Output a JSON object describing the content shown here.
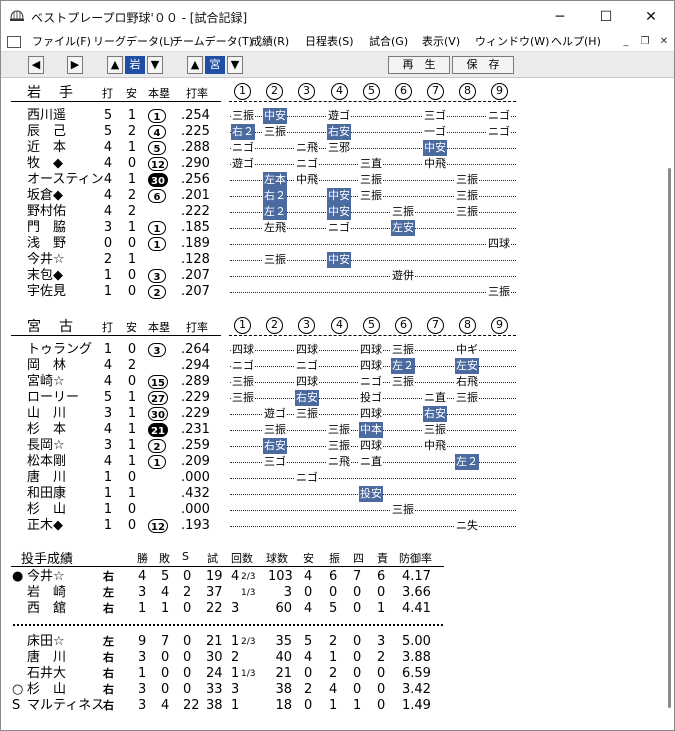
{
  "window": {
    "title": "ベストプレープロ野球'００ - [試合記録]"
  },
  "menu": [
    "ファイル(F)",
    "リーグデータ(L)",
    "チームデータ(T)",
    "成績(R)",
    "日程表(S)",
    "試合(G)",
    "表示(V)",
    "ウィンドウ(W)",
    "ヘルプ(H)"
  ],
  "toolbar": {
    "team1": "岩",
    "team2": "宮",
    "play": "再　生",
    "save": "保　存"
  },
  "cols": {
    "ab": "打",
    "h": "安",
    "hr": "本塁",
    "avg": "打率",
    "innings": [
      "1",
      "2",
      "3",
      "4",
      "5",
      "6",
      "7",
      "8",
      "9"
    ]
  },
  "team1": {
    "name": "岩　手",
    "players": [
      {
        "name": "西川遥",
        "ab": "5",
        "h": "1",
        "hr": "1",
        "hrf": false,
        "avg": ".254",
        "res": [
          [
            "三振",
            0
          ],
          [
            "中安",
            1
          ],
          [
            "",
            0
          ],
          [
            "遊ゴ",
            0
          ],
          [
            "",
            0
          ],
          [
            "",
            0
          ],
          [
            "三ゴ",
            0
          ],
          [
            "",
            0
          ],
          [
            "ニゴ",
            0
          ]
        ]
      },
      {
        "name": "辰　己",
        "ab": "5",
        "h": "2",
        "hr": "4",
        "hrf": false,
        "avg": ".225",
        "res": [
          [
            "右２",
            1
          ],
          [
            "三振",
            0
          ],
          [
            "",
            0
          ],
          [
            "右安",
            1
          ],
          [
            "",
            0
          ],
          [
            "",
            0
          ],
          [
            "一ゴ",
            0
          ],
          [
            "",
            0
          ],
          [
            "ニゴ",
            0
          ]
        ]
      },
      {
        "name": "近　本",
        "ab": "4",
        "h": "1",
        "hr": "5",
        "hrf": false,
        "avg": ".288",
        "res": [
          [
            "ニゴ",
            0
          ],
          [
            "",
            0
          ],
          [
            "ニ飛",
            0
          ],
          [
            "三邪",
            0
          ],
          [
            "",
            0
          ],
          [
            "",
            0
          ],
          [
            "中安",
            1
          ],
          [
            "",
            0
          ],
          [
            "",
            0
          ]
        ]
      },
      {
        "name": "牧　◆",
        "ab": "4",
        "h": "0",
        "hr": "12",
        "hrf": false,
        "avg": ".290",
        "res": [
          [
            "遊ゴ",
            0
          ],
          [
            "",
            0
          ],
          [
            "ニゴ",
            0
          ],
          [
            "",
            0
          ],
          [
            "三直",
            0
          ],
          [
            "",
            0
          ],
          [
            "中飛",
            0
          ],
          [
            "",
            0
          ],
          [
            "",
            0
          ]
        ]
      },
      {
        "name": "オースティン",
        "ab": "4",
        "h": "1",
        "hr": "30",
        "hrf": true,
        "avg": ".256",
        "res": [
          [
            "",
            0
          ],
          [
            "左本",
            1
          ],
          [
            "中飛",
            0
          ],
          [
            "",
            0
          ],
          [
            "三振",
            0
          ],
          [
            "",
            0
          ],
          [
            "",
            0
          ],
          [
            "三振",
            0
          ],
          [
            "",
            0
          ]
        ]
      },
      {
        "name": "坂倉◆",
        "ab": "4",
        "h": "2",
        "hr": "6",
        "hrf": false,
        "avg": ".201",
        "res": [
          [
            "",
            0
          ],
          [
            "右２",
            1
          ],
          [
            "",
            0
          ],
          [
            "中安",
            1
          ],
          [
            "三振",
            0
          ],
          [
            "",
            0
          ],
          [
            "",
            0
          ],
          [
            "三振",
            0
          ],
          [
            "",
            0
          ]
        ]
      },
      {
        "name": "野村佑",
        "ab": "4",
        "h": "2",
        "hr": "",
        "hrf": false,
        "avg": ".222",
        "res": [
          [
            "",
            0
          ],
          [
            "左２",
            1
          ],
          [
            "",
            0
          ],
          [
            "中安",
            1
          ],
          [
            "",
            0
          ],
          [
            "三振",
            0
          ],
          [
            "",
            0
          ],
          [
            "三振",
            0
          ],
          [
            "",
            0
          ]
        ]
      },
      {
        "name": "門　脇",
        "ab": "3",
        "h": "1",
        "hr": "1",
        "hrf": false,
        "avg": ".185",
        "res": [
          [
            "",
            0
          ],
          [
            "左飛",
            0
          ],
          [
            "",
            0
          ],
          [
            "ニゴ",
            0
          ],
          [
            "",
            0
          ],
          [
            "左安",
            1
          ],
          [
            "",
            0
          ],
          [
            "",
            0
          ],
          [
            "",
            0
          ]
        ]
      },
      {
        "name": "浅　野",
        "ab": "0",
        "h": "0",
        "hr": "1",
        "hrf": false,
        "avg": ".189",
        "res": [
          [
            "",
            0
          ],
          [
            "",
            0
          ],
          [
            "",
            0
          ],
          [
            "",
            0
          ],
          [
            "",
            0
          ],
          [
            "",
            0
          ],
          [
            "",
            0
          ],
          [
            "",
            0
          ],
          [
            "四球",
            0
          ]
        ]
      },
      {
        "name": "今井☆",
        "ab": "2",
        "h": "1",
        "hr": "",
        "hrf": false,
        "avg": ".128",
        "res": [
          [
            "",
            0
          ],
          [
            "三振",
            0
          ],
          [
            "",
            0
          ],
          [
            "中安",
            1
          ],
          [
            "",
            0
          ],
          [
            "",
            0
          ],
          [
            "",
            0
          ],
          [
            "",
            0
          ],
          [
            "",
            0
          ]
        ]
      },
      {
        "name": "末包◆",
        "ab": "1",
        "h": "0",
        "hr": "3",
        "hrf": false,
        "avg": ".207",
        "res": [
          [
            "",
            0
          ],
          [
            "",
            0
          ],
          [
            "",
            0
          ],
          [
            "",
            0
          ],
          [
            "",
            0
          ],
          [
            "遊併",
            0
          ],
          [
            "",
            0
          ],
          [
            "",
            0
          ],
          [
            "",
            0
          ]
        ]
      },
      {
        "name": "宇佐見",
        "ab": "1",
        "h": "0",
        "hr": "2",
        "hrf": false,
        "avg": ".207",
        "res": [
          [
            "",
            0
          ],
          [
            "",
            0
          ],
          [
            "",
            0
          ],
          [
            "",
            0
          ],
          [
            "",
            0
          ],
          [
            "",
            0
          ],
          [
            "",
            0
          ],
          [
            "",
            0
          ],
          [
            "三振",
            0
          ]
        ]
      }
    ]
  },
  "team2": {
    "name": "宮　古",
    "players": [
      {
        "name": "トゥラング",
        "ab": "1",
        "h": "0",
        "hr": "3",
        "hrf": false,
        "avg": ".264",
        "res": [
          [
            "四球",
            0
          ],
          [
            "",
            0
          ],
          [
            "四球",
            0
          ],
          [
            "",
            0
          ],
          [
            "四球",
            0
          ],
          [
            "三振",
            0
          ],
          [
            "",
            0
          ],
          [
            "中ギ",
            0
          ],
          [
            "",
            0
          ]
        ]
      },
      {
        "name": "岡　林",
        "ab": "4",
        "h": "2",
        "hr": "",
        "hrf": false,
        "avg": ".294",
        "res": [
          [
            "ニゴ",
            0
          ],
          [
            "",
            0
          ],
          [
            "ニゴ",
            0
          ],
          [
            "",
            0
          ],
          [
            "四球",
            0
          ],
          [
            "左２",
            1
          ],
          [
            "",
            0
          ],
          [
            "左安",
            1
          ],
          [
            "",
            0
          ]
        ]
      },
      {
        "name": "宮崎☆",
        "ab": "4",
        "h": "0",
        "hr": "15",
        "hrf": false,
        "avg": ".289",
        "res": [
          [
            "三振",
            0
          ],
          [
            "",
            0
          ],
          [
            "四球",
            0
          ],
          [
            "",
            0
          ],
          [
            "ニゴ",
            0
          ],
          [
            "三振",
            0
          ],
          [
            "",
            0
          ],
          [
            "右飛",
            0
          ],
          [
            "",
            0
          ]
        ]
      },
      {
        "name": "ローリー",
        "ab": "5",
        "h": "1",
        "hr": "27",
        "hrf": false,
        "avg": ".229",
        "res": [
          [
            "三振",
            0
          ],
          [
            "",
            0
          ],
          [
            "右安",
            1
          ],
          [
            "",
            0
          ],
          [
            "投ゴ",
            0
          ],
          [
            "",
            0
          ],
          [
            "ニ直",
            0
          ],
          [
            "三振",
            0
          ],
          [
            "",
            0
          ]
        ]
      },
      {
        "name": "山　川",
        "ab": "3",
        "h": "1",
        "hr": "30",
        "hrf": false,
        "avg": ".229",
        "res": [
          [
            "",
            0
          ],
          [
            "遊ゴ",
            0
          ],
          [
            "三振",
            0
          ],
          [
            "",
            0
          ],
          [
            "四球",
            0
          ],
          [
            "",
            0
          ],
          [
            "右安",
            1
          ],
          [
            "",
            0
          ],
          [
            "",
            0
          ]
        ]
      },
      {
        "name": "杉　本",
        "ab": "4",
        "h": "1",
        "hr": "21",
        "hrf": true,
        "avg": ".231",
        "res": [
          [
            "",
            0
          ],
          [
            "三振",
            0
          ],
          [
            "",
            0
          ],
          [
            "三振",
            0
          ],
          [
            "中本",
            1
          ],
          [
            "",
            0
          ],
          [
            "三振",
            0
          ],
          [
            "",
            0
          ],
          [
            "",
            0
          ]
        ]
      },
      {
        "name": "長岡☆",
        "ab": "3",
        "h": "1",
        "hr": "2",
        "hrf": false,
        "avg": ".259",
        "res": [
          [
            "",
            0
          ],
          [
            "右安",
            1
          ],
          [
            "",
            0
          ],
          [
            "三振",
            0
          ],
          [
            "四球",
            0
          ],
          [
            "",
            0
          ],
          [
            "中飛",
            0
          ],
          [
            "",
            0
          ],
          [
            "",
            0
          ]
        ]
      },
      {
        "name": "松本剛",
        "ab": "4",
        "h": "1",
        "hr": "1",
        "hrf": false,
        "avg": ".209",
        "res": [
          [
            "",
            0
          ],
          [
            "三ゴ",
            0
          ],
          [
            "",
            0
          ],
          [
            "ニ飛",
            0
          ],
          [
            "ニ直",
            0
          ],
          [
            "",
            0
          ],
          [
            "",
            0
          ],
          [
            "左２",
            1
          ],
          [
            "",
            0
          ]
        ]
      },
      {
        "name": "唐　川",
        "ab": "1",
        "h": "0",
        "hr": "",
        "hrf": false,
        "avg": ".000",
        "res": [
          [
            "",
            0
          ],
          [
            "",
            0
          ],
          [
            "ニゴ",
            0
          ],
          [
            "",
            0
          ],
          [
            "",
            0
          ],
          [
            "",
            0
          ],
          [
            "",
            0
          ],
          [
            "",
            0
          ],
          [
            "",
            0
          ]
        ]
      },
      {
        "name": "和田康",
        "ab": "1",
        "h": "1",
        "hr": "",
        "hrf": false,
        "avg": ".432",
        "res": [
          [
            "",
            0
          ],
          [
            "",
            0
          ],
          [
            "",
            0
          ],
          [
            "",
            0
          ],
          [
            "投安",
            1
          ],
          [
            "",
            0
          ],
          [
            "",
            0
          ],
          [
            "",
            0
          ],
          [
            "",
            0
          ]
        ]
      },
      {
        "name": "杉　山",
        "ab": "1",
        "h": "0",
        "hr": "",
        "hrf": false,
        "avg": ".000",
        "res": [
          [
            "",
            0
          ],
          [
            "",
            0
          ],
          [
            "",
            0
          ],
          [
            "",
            0
          ],
          [
            "",
            0
          ],
          [
            "三振",
            0
          ],
          [
            "",
            0
          ],
          [
            "",
            0
          ],
          [
            "",
            0
          ]
        ]
      },
      {
        "name": "正木◆",
        "ab": "1",
        "h": "0",
        "hr": "12",
        "hrf": false,
        "avg": ".193",
        "res": [
          [
            "",
            0
          ],
          [
            "",
            0
          ],
          [
            "",
            0
          ],
          [
            "",
            0
          ],
          [
            "",
            0
          ],
          [
            "",
            0
          ],
          [
            "",
            0
          ],
          [
            "ニ失",
            0
          ],
          [
            "",
            0
          ]
        ]
      }
    ]
  },
  "pitching": {
    "title": "投手成績",
    "headers": [
      "勝",
      "敗",
      "S",
      "試",
      "回数",
      "球数",
      "安",
      "振",
      "四",
      "責",
      "防御率"
    ],
    "rows1": [
      {
        "mark": "●",
        "name": "今井☆",
        "hand": "右",
        "w": "4",
        "l": "5",
        "s": "0",
        "g": "19",
        "ip": "4",
        "ipf": "2/3",
        "np": "103",
        "h": "4",
        "k": "6",
        "bb": "7",
        "er": "6",
        "era": "4.17"
      },
      {
        "mark": "",
        "name": "岩　崎",
        "hand": "左",
        "w": "3",
        "l": "4",
        "s": "2",
        "g": "37",
        "ip": "",
        "ipf": "1/3",
        "np": "3",
        "h": "0",
        "k": "0",
        "bb": "0",
        "er": "0",
        "era": "3.66"
      },
      {
        "mark": "",
        "name": "西　舘",
        "hand": "右",
        "w": "1",
        "l": "1",
        "s": "0",
        "g": "22",
        "ip": "3",
        "ipf": "",
        "np": "60",
        "h": "4",
        "k": "5",
        "bb": "0",
        "er": "1",
        "era": "4.41"
      }
    ],
    "rows2": [
      {
        "mark": "",
        "name": "床田☆",
        "hand": "左",
        "w": "9",
        "l": "7",
        "s": "0",
        "g": "21",
        "ip": "1",
        "ipf": "2/3",
        "np": "35",
        "h": "5",
        "k": "2",
        "bb": "0",
        "er": "3",
        "era": "5.00"
      },
      {
        "mark": "",
        "name": "唐　川",
        "hand": "右",
        "w": "3",
        "l": "0",
        "s": "0",
        "g": "30",
        "ip": "2",
        "ipf": "",
        "np": "40",
        "h": "4",
        "k": "1",
        "bb": "0",
        "er": "2",
        "era": "3.88"
      },
      {
        "mark": "",
        "name": "石井大",
        "hand": "右",
        "w": "1",
        "l": "0",
        "s": "0",
        "g": "24",
        "ip": "1",
        "ipf": "1/3",
        "np": "21",
        "h": "0",
        "k": "2",
        "bb": "0",
        "er": "0",
        "era": "6.59"
      },
      {
        "mark": "○",
        "name": "杉　山",
        "hand": "右",
        "w": "3",
        "l": "0",
        "s": "0",
        "g": "33",
        "ip": "3",
        "ipf": "",
        "np": "38",
        "h": "2",
        "k": "4",
        "bb": "0",
        "er": "0",
        "era": "3.42"
      },
      {
        "mark": "S",
        "name": "マルティネス",
        "hand": "右",
        "w": "3",
        "l": "4",
        "s": "22",
        "g": "38",
        "ip": "1",
        "ipf": "",
        "np": "18",
        "h": "0",
        "k": "1",
        "bb": "1",
        "er": "0",
        "era": "1.49"
      }
    ]
  }
}
